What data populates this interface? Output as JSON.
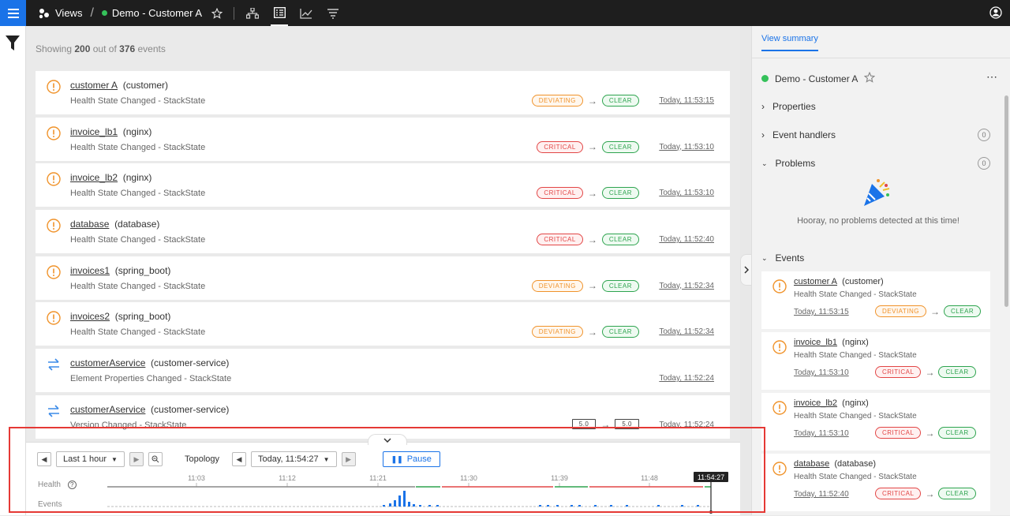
{
  "topbar": {
    "views_label": "Views",
    "view_name": "Demo - Customer A"
  },
  "main": {
    "showing_prefix": "Showing",
    "showing_count": "200",
    "showing_middle": "out of",
    "showing_total": "376",
    "showing_suffix": "events",
    "events": [
      {
        "name": "customer A",
        "type": "(customer)",
        "desc": "Health State Changed  -  StackState",
        "from": "DEVIATING",
        "to": "CLEAR",
        "time": "Today, 11:53:15",
        "kind": "health"
      },
      {
        "name": "invoice_lb1",
        "type": "(nginx)",
        "desc": "Health State Changed  -  StackState",
        "from": "CRITICAL",
        "to": "CLEAR",
        "time": "Today, 11:53:10",
        "kind": "health"
      },
      {
        "name": "invoice_lb2",
        "type": "(nginx)",
        "desc": "Health State Changed  -  StackState",
        "from": "CRITICAL",
        "to": "CLEAR",
        "time": "Today, 11:53:10",
        "kind": "health"
      },
      {
        "name": "database",
        "type": "(database)",
        "desc": "Health State Changed  -  StackState",
        "from": "CRITICAL",
        "to": "CLEAR",
        "time": "Today, 11:52:40",
        "kind": "health"
      },
      {
        "name": "invoices1",
        "type": "(spring_boot)",
        "desc": "Health State Changed  -  StackState",
        "from": "DEVIATING",
        "to": "CLEAR",
        "time": "Today, 11:52:34",
        "kind": "health"
      },
      {
        "name": "invoices2",
        "type": "(spring_boot)",
        "desc": "Health State Changed  -  StackState",
        "from": "DEVIATING",
        "to": "CLEAR",
        "time": "Today, 11:52:34",
        "kind": "health"
      },
      {
        "name": "customerAservice",
        "type": "(customer-service)",
        "desc": "Element Properties Changed  -  StackState",
        "from": "",
        "to": "",
        "time": "Today, 11:52:24",
        "kind": "change"
      },
      {
        "name": "customerAservice",
        "type": "(customer-service)",
        "desc": "Version Changed  -  StackState",
        "from": "5.0",
        "to": "5.0",
        "time": "Today, 11:52:24",
        "kind": "version"
      }
    ]
  },
  "timeline": {
    "range_label": "Last 1 hour",
    "topology_label": "Topology",
    "time_label": "Today, 11:54:27",
    "pause_label": "Pause",
    "health_label": "Health",
    "events_label": "Events",
    "ticks": [
      "11:03",
      "11:12",
      "11:21",
      "11:30",
      "11:39",
      "11:48"
    ],
    "cursor_label": "11:54:27"
  },
  "right": {
    "tab_label": "View summary",
    "title": "Demo - Customer A",
    "properties_label": "Properties",
    "handlers_label": "Event handlers",
    "handlers_count": "0",
    "problems_label": "Problems",
    "problems_count": "0",
    "hooray": "Hooray, no problems detected at this time!",
    "events_label": "Events",
    "events": [
      {
        "name": "customer A",
        "type": "(customer)",
        "desc": "Health State Changed  -  StackState",
        "time": "Today, 11:53:15",
        "from": "DEVIATING",
        "to": "CLEAR"
      },
      {
        "name": "invoice_lb1",
        "type": "(nginx)",
        "desc": "Health State Changed  -  StackState",
        "time": "Today, 11:53:10",
        "from": "CRITICAL",
        "to": "CLEAR"
      },
      {
        "name": "invoice_lb2",
        "type": "(nginx)",
        "desc": "Health State Changed  -  StackState",
        "time": "Today, 11:53:10",
        "from": "CRITICAL",
        "to": "CLEAR"
      },
      {
        "name": "database",
        "type": "(database)",
        "desc": "Health State Changed  -  StackState",
        "time": "Today, 11:52:40",
        "from": "CRITICAL",
        "to": "CLEAR"
      }
    ]
  },
  "colors": {
    "accent": "#1a73e8",
    "deviating": "#f0932b",
    "critical": "#e24646",
    "clear": "#2ea44f",
    "annotation": "#e53935"
  }
}
